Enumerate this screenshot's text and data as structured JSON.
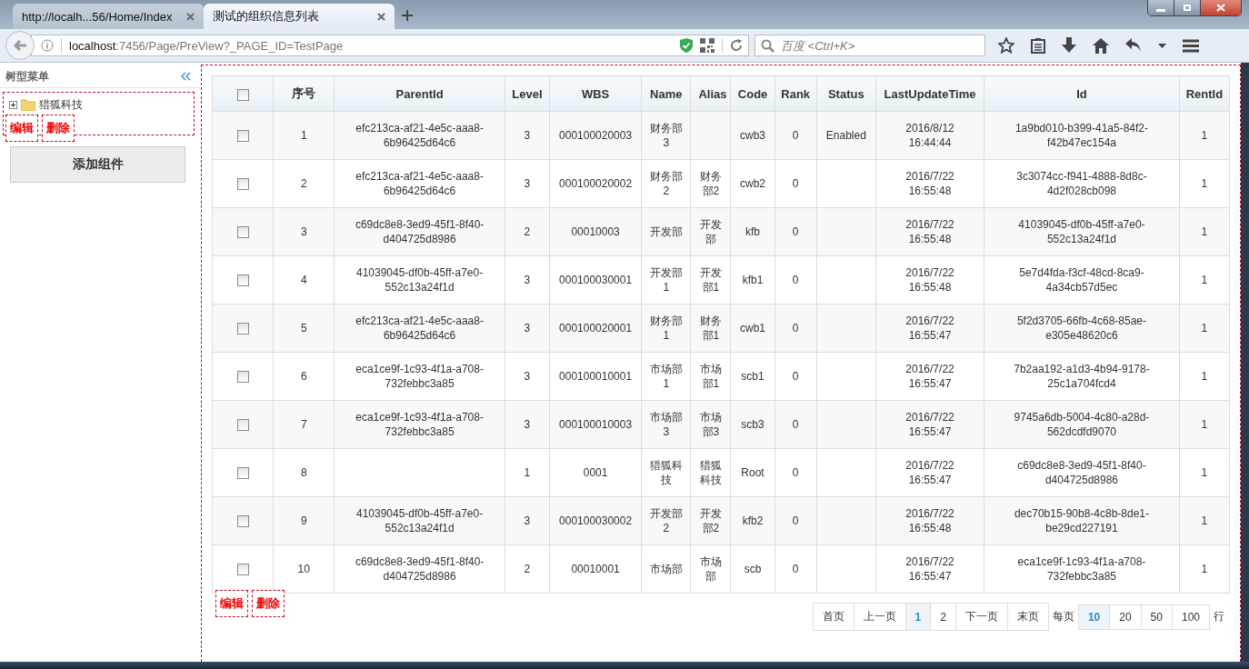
{
  "browser": {
    "tabs": [
      {
        "title": "http://localh...56/Home/Index",
        "selected": false
      },
      {
        "title": "测试的组织信息列表",
        "selected": true
      }
    ],
    "url_host": "localhost",
    "url_path": ":7456/Page/PreView?_PAGE_ID=TestPage",
    "search_placeholder": "百度 <Ctrl+K>"
  },
  "sidebar": {
    "title": "树型菜单",
    "tree": [
      {
        "label": "猎狐科技",
        "expanded": false
      }
    ],
    "actions": [
      "编辑",
      "删除"
    ],
    "add_button": "添加组件"
  },
  "table": {
    "columns": [
      "序号",
      "ParentId",
      "Level",
      "WBS",
      "Name",
      "Alias",
      "Code",
      "Rank",
      "Status",
      "LastUpdateTime",
      "Id",
      "RentId"
    ],
    "header_checked": false,
    "rows": [
      {
        "checked": false,
        "cells": [
          "1",
          "efc213ca-af21-4e5c-aaa8-6b96425d64c6",
          "3",
          "000100020003",
          "财务部3",
          "",
          "cwb3",
          "0",
          "Enabled",
          "2016/8/12 16:44:44",
          "1a9bd010-b399-41a5-84f2-f42b47ec154a",
          "1"
        ]
      },
      {
        "checked": false,
        "cells": [
          "2",
          "efc213ca-af21-4e5c-aaa8-6b96425d64c6",
          "3",
          "000100020002",
          "财务部2",
          "财务部2",
          "cwb2",
          "0",
          "",
          "2016/7/22 16:55:48",
          "3c3074cc-f941-4888-8d8c-4d2f028cb098",
          "1"
        ]
      },
      {
        "checked": false,
        "cells": [
          "3",
          "c69dc8e8-3ed9-45f1-8f40-d404725d8986",
          "2",
          "00010003",
          "开发部",
          "开发部",
          "kfb",
          "0",
          "",
          "2016/7/22 16:55:48",
          "41039045-df0b-45ff-a7e0-552c13a24f1d",
          "1"
        ]
      },
      {
        "checked": false,
        "cells": [
          "4",
          "41039045-df0b-45ff-a7e0-552c13a24f1d",
          "3",
          "000100030001",
          "开发部1",
          "开发部1",
          "kfb1",
          "0",
          "",
          "2016/7/22 16:55:48",
          "5e7d4fda-f3cf-48cd-8ca9-4a34cb57d5ec",
          "1"
        ]
      },
      {
        "checked": false,
        "cells": [
          "5",
          "efc213ca-af21-4e5c-aaa8-6b96425d64c6",
          "3",
          "000100020001",
          "财务部1",
          "财务部1",
          "cwb1",
          "0",
          "",
          "2016/7/22 16:55:47",
          "5f2d3705-66fb-4c68-85ae-e305e48620c6",
          "1"
        ]
      },
      {
        "checked": false,
        "cells": [
          "6",
          "eca1ce9f-1c93-4f1a-a708-732febbc3a85",
          "3",
          "000100010001",
          "市场部1",
          "市场部1",
          "scb1",
          "0",
          "",
          "2016/7/22 16:55:47",
          "7b2aa192-a1d3-4b94-9178-25c1a704fcd4",
          "1"
        ]
      },
      {
        "checked": false,
        "cells": [
          "7",
          "eca1ce9f-1c93-4f1a-a708-732febbc3a85",
          "3",
          "000100010003",
          "市场部3",
          "市场部3",
          "scb3",
          "0",
          "",
          "2016/7/22 16:55:47",
          "9745a6db-5004-4c80-a28d-562dcdfd9070",
          "1"
        ]
      },
      {
        "checked": false,
        "cells": [
          "8",
          "",
          "1",
          "0001",
          "猎狐科技",
          "猎狐科技",
          "Root",
          "0",
          "",
          "2016/7/22 16:55:47",
          "c69dc8e8-3ed9-45f1-8f40-d404725d8986",
          "1"
        ]
      },
      {
        "checked": false,
        "cells": [
          "9",
          "41039045-df0b-45ff-a7e0-552c13a24f1d",
          "3",
          "000100030002",
          "开发部2",
          "开发部2",
          "kfb2",
          "0",
          "",
          "2016/7/22 16:55:48",
          "dec70b15-90b8-4c8b-8de1-be29cd227191",
          "1"
        ]
      },
      {
        "checked": false,
        "cells": [
          "10",
          "c69dc8e8-3ed9-45f1-8f40-d404725d8986",
          "2",
          "00010001",
          "市场部",
          "市场部",
          "scb",
          "0",
          "",
          "2016/7/22 16:55:47",
          "eca1ce9f-1c93-4f1a-a708-732febbc3a85",
          "1"
        ]
      }
    ],
    "actions": [
      "编辑",
      "删除"
    ]
  },
  "pager": {
    "pages": [
      {
        "label": "首页",
        "selected": false
      },
      {
        "label": "上一页",
        "selected": false
      },
      {
        "label": "1",
        "selected": true
      },
      {
        "label": "2",
        "selected": false
      },
      {
        "label": "下一页",
        "selected": false
      },
      {
        "label": "末页",
        "selected": false
      }
    ],
    "size_label": "每页",
    "sizes": [
      {
        "label": "10",
        "selected": true
      },
      {
        "label": "20",
        "selected": false
      },
      {
        "label": "50",
        "selected": false
      },
      {
        "label": "100",
        "selected": false
      }
    ],
    "rows_label": "行"
  }
}
